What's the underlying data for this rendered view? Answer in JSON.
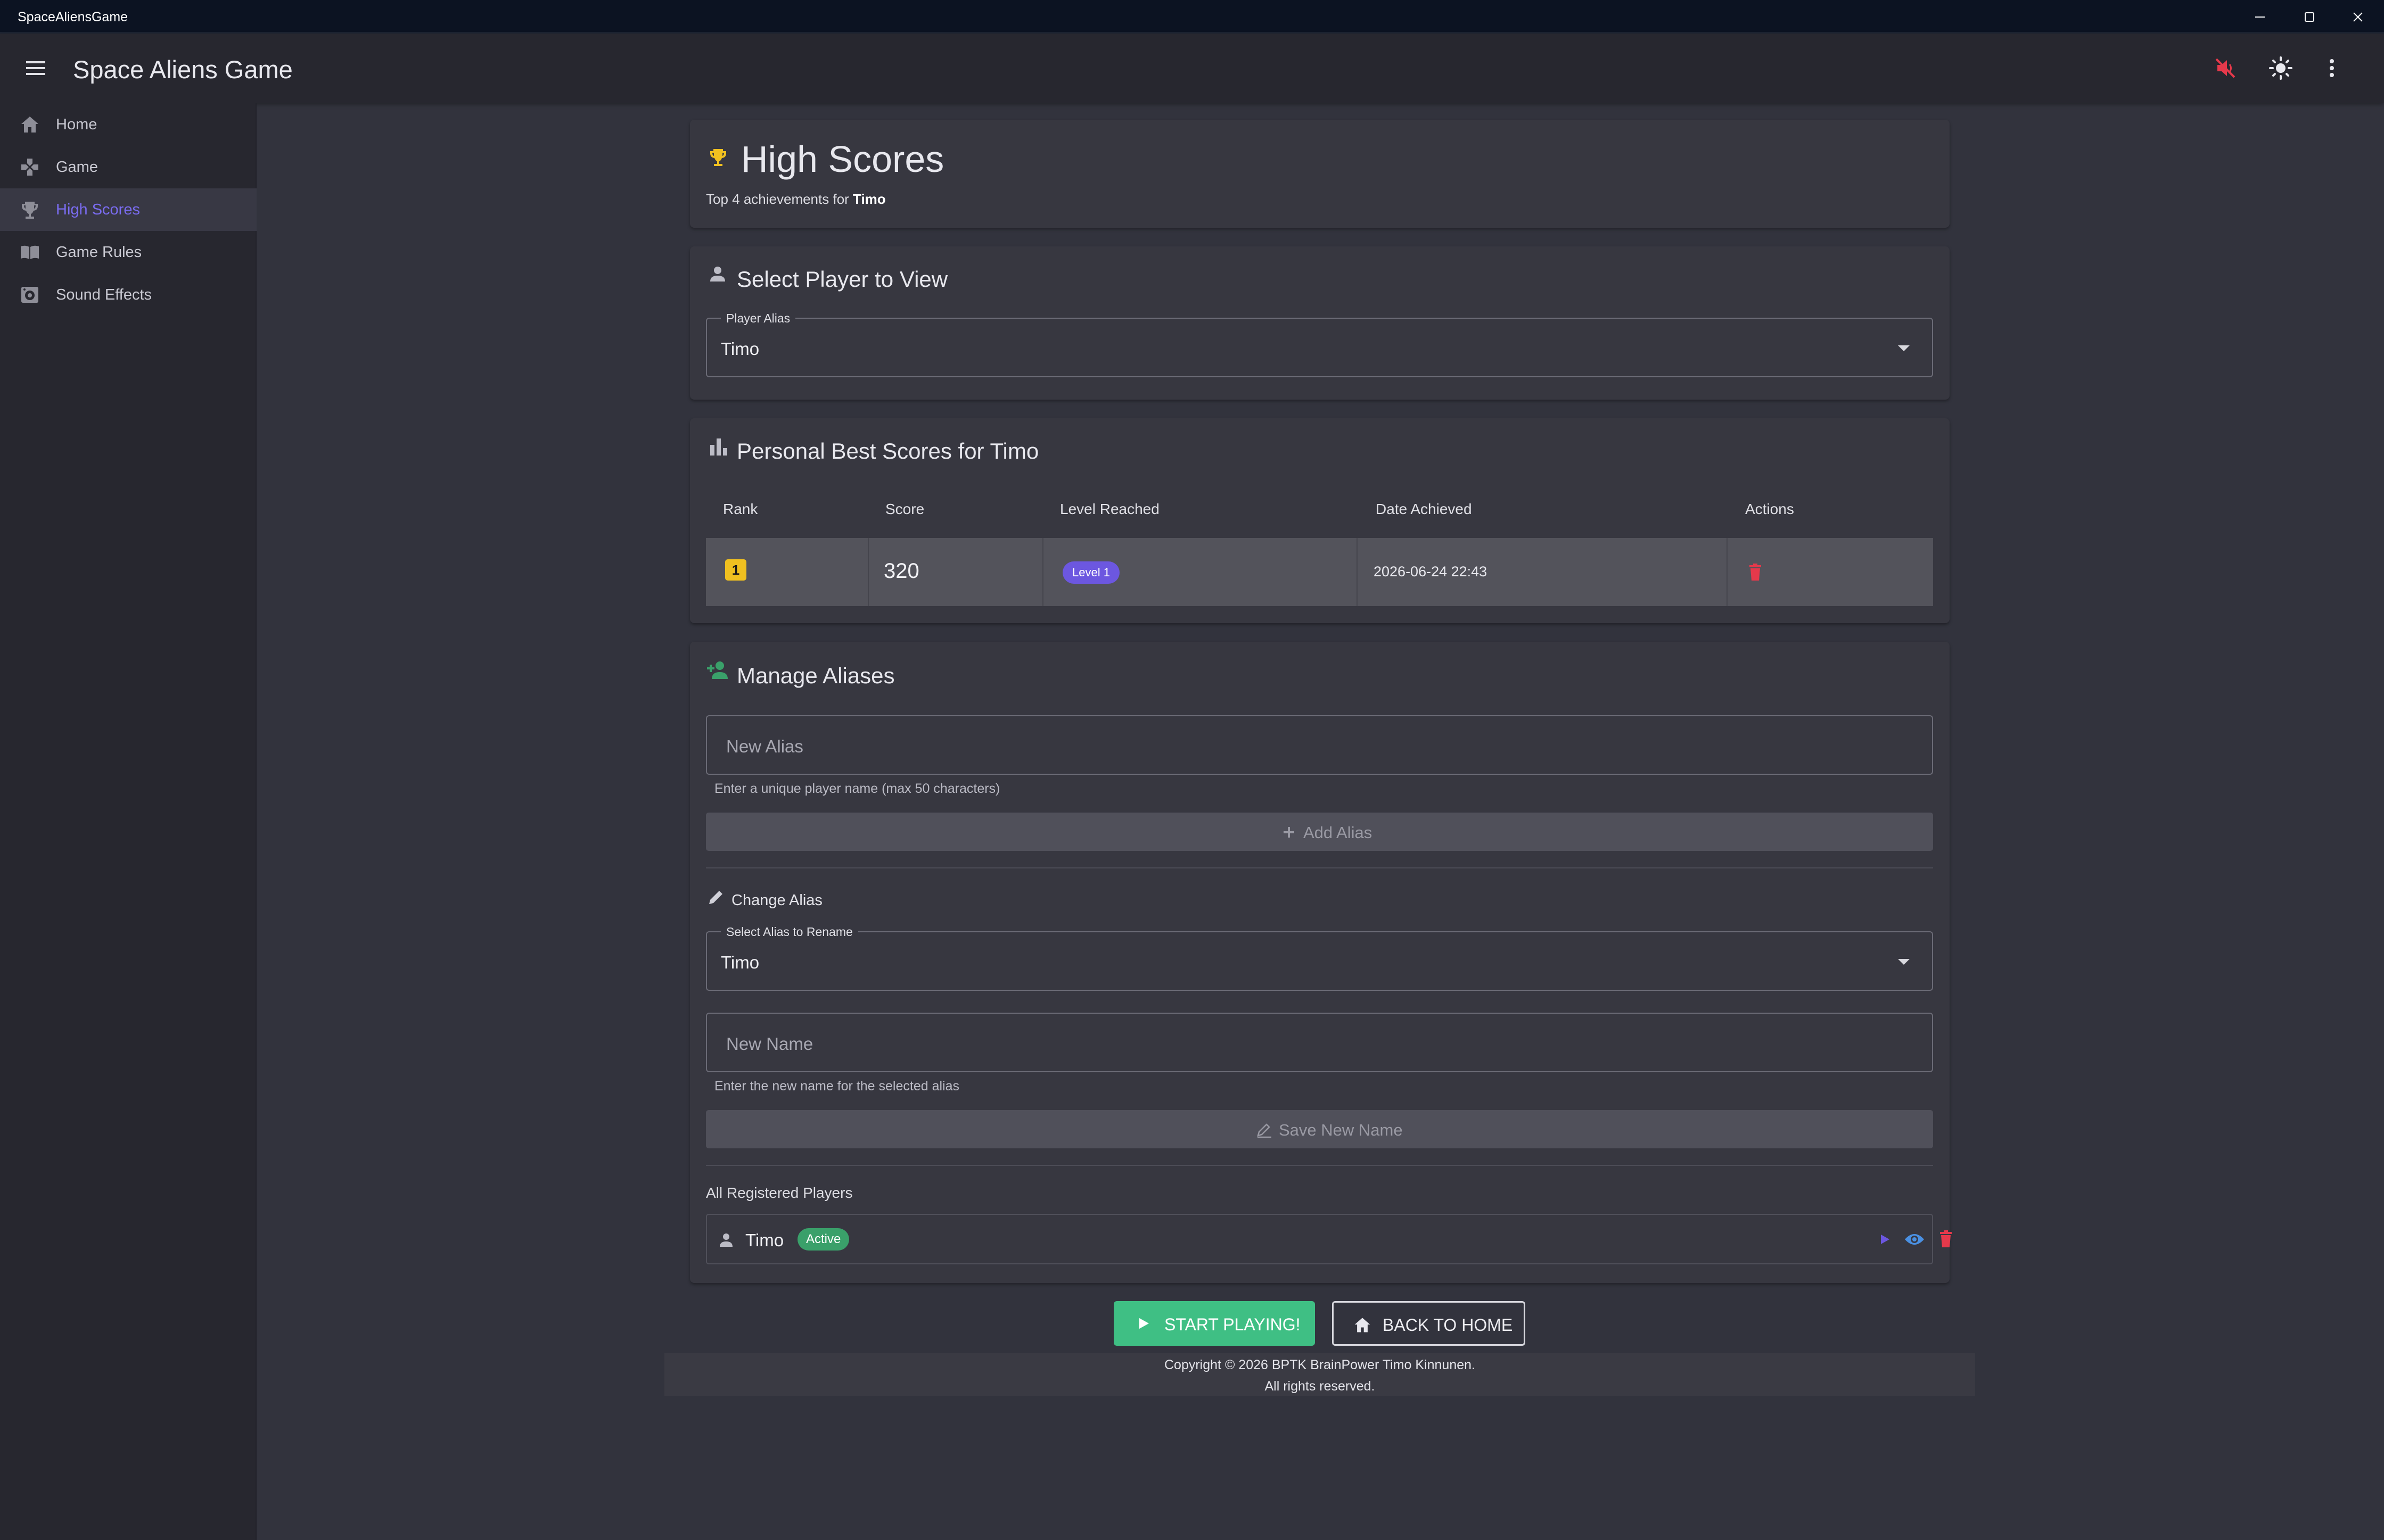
{
  "window": {
    "title": "SpaceAliensGame",
    "controls": {
      "minimize": "minimize-icon",
      "maximize": "maximize-icon",
      "close": "close-icon"
    }
  },
  "appbar": {
    "title": "Space Aliens Game",
    "icons": [
      "menu-icon",
      "volume-off-icon",
      "brightness-icon",
      "more-vert-icon"
    ]
  },
  "sidebar": {
    "items": [
      {
        "label": "Home",
        "icon": "home-icon"
      },
      {
        "label": "Game",
        "icon": "gamepad-icon"
      },
      {
        "label": "High Scores",
        "icon": "trophy-icon",
        "active": true
      },
      {
        "label": "Game Rules",
        "icon": "book-icon"
      },
      {
        "label": "Sound Effects",
        "icon": "speaker-icon"
      }
    ]
  },
  "header": {
    "title": "High Scores",
    "subtitle_prefix": "Top 4 achievements for",
    "subtitle_player": "Timo"
  },
  "select_player": {
    "title": "Select Player to View",
    "field_label": "Player Alias",
    "value": "Timo"
  },
  "scores": {
    "title": "Personal Best Scores for Timo",
    "columns": [
      "Rank",
      "Score",
      "Level Reached",
      "Date Achieved",
      "Actions"
    ],
    "rows": [
      {
        "rank": "1",
        "score": "320",
        "level": "Level 1",
        "date": "2026-06-24 22:43"
      }
    ]
  },
  "aliases": {
    "title": "Manage Aliases",
    "new_alias_placeholder": "New Alias",
    "new_alias_hint": "Enter a unique player name (max 50 characters)",
    "add_button": "Add Alias",
    "change_title": "Change Alias",
    "rename_label": "Select Alias to Rename",
    "rename_value": "Timo",
    "new_name_placeholder": "New Name",
    "new_name_hint": "Enter the new name for the selected alias",
    "save_button": "Save New Name",
    "players_title": "All Registered Players",
    "players": [
      {
        "name": "Timo",
        "status": "Active"
      }
    ]
  },
  "actions": {
    "start": "START PLAYING!",
    "home": "BACK TO HOME"
  },
  "footer": {
    "line1": "Copyright © 2026 BPTK BrainPower Timo Kinnunen.",
    "line2": "All rights reserved."
  },
  "colors": {
    "accent": "#7a6cf0",
    "trophy": "#f0c020",
    "success": "#3aa06a",
    "danger": "#e5394b",
    "info": "#4a90e2"
  }
}
